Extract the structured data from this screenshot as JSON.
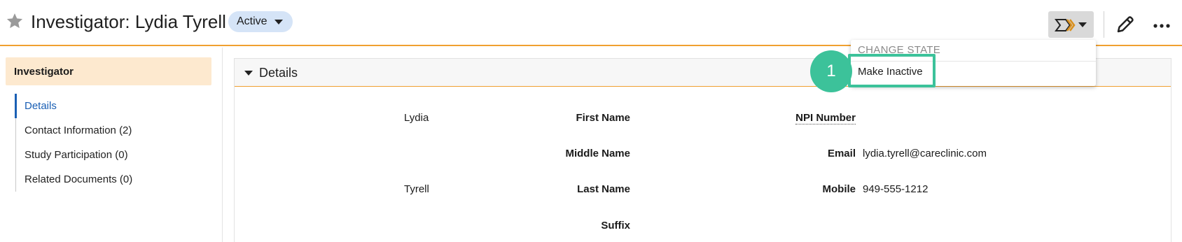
{
  "header": {
    "title": "Investigator: Lydia Tyrell",
    "status": "Active",
    "icons": [
      "star-icon",
      "state-change-icon",
      "pencil-icon",
      "ellipsis-icon"
    ]
  },
  "leftnav": {
    "heading": "Investigator",
    "items": [
      {
        "label": "Details",
        "active": true
      },
      {
        "label": "Contact Information (2)"
      },
      {
        "label": "Study Participation (0)"
      },
      {
        "label": "Related Documents (0)"
      }
    ]
  },
  "section": {
    "title": "Details",
    "fields": {
      "first_name_label": "First Name",
      "first_name_value": "Lydia",
      "middle_name_label": "Middle Name",
      "middle_name_value": "",
      "last_name_label": "Last Name",
      "last_name_value": "Tyrell",
      "suffix_label": "Suffix",
      "suffix_value": "",
      "npi_label": "NPI Number",
      "npi_value": "",
      "email_label": "Email",
      "email_value": "lydia.tyrell@careclinic.com",
      "mobile_label": "Mobile",
      "mobile_value": "949-555-1212"
    }
  },
  "dropdown": {
    "header": "CHANGE STATE",
    "item": "Make Inactive"
  },
  "callout": {
    "step": "1",
    "color": "#3cc29a"
  },
  "colors": {
    "accent": "#f0a030",
    "link": "#1a5fb4",
    "status_pill": "#d5e4f7",
    "nav_heading_bg": "#fde9cf"
  }
}
